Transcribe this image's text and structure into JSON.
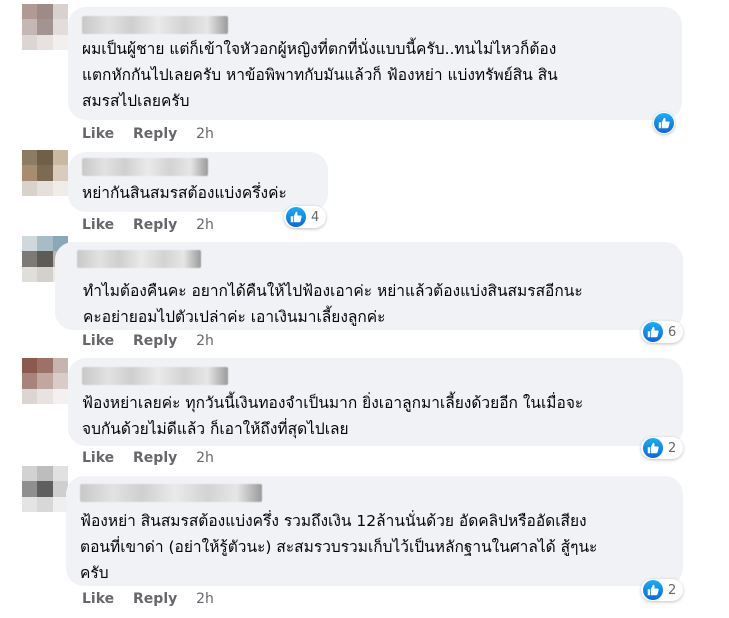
{
  "comments": [
    {
      "lines": [
        "ผมเป็นผู้ชาย แต่ก็เข้าใจหัวอกผู้หญิงที่ตกที่นั่งแบบนี้ครับ..ทนไม่ไหวก็ต้อง",
        "แตกหักกันไปเลยครับ หาข้อพิพาทกับมันแล้วก็ ฟ้องหย่า แบ่งทรัพย์สิน สิน",
        "สมรสไปเลยครับ"
      ],
      "like": "Like",
      "reply": "Reply",
      "time": "2h",
      "reaction_count": ""
    },
    {
      "lines": [
        "หย่ากันสินสมรสต้องแบ่งครึ่งค่ะ"
      ],
      "like": "Like",
      "reply": "Reply",
      "time": "2h",
      "reaction_count": "4"
    },
    {
      "lines": [
        "ทำไมต้องคืนคะ อยากได้คืนให้ไปฟ้องเอาค่ะ หย่าแล้วต้องแบ่งสินสมรสอีกนะ",
        "คะอย่ายอมไปตัวเปล่าค่ะ เอาเงินมาเลี้ยงลูกค่ะ"
      ],
      "like": "Like",
      "reply": "Reply",
      "time": "2h",
      "reaction_count": "6"
    },
    {
      "lines": [
        "ฟ้องหย่าเลยค่ะ ทุกวันนี้เงินทองจำเป็นมาก ยิ่งเอาลูกมาเลี้ยงด้วยอีก ในเมื่อจะ",
        "จบกันด้วยไม่ดีแล้ว ก็เอาให้ถึงที่สุดไปเลย"
      ],
      "like": "Like",
      "reply": "Reply",
      "time": "2h",
      "reaction_count": "2"
    },
    {
      "lines": [
        "ฟ้องหย่า สินสมรสต้องแบ่งครึ่ง รวมถึงเงิน 12ล้านนั่นด้วย อัดคลิปหรืออัดเสียง",
        "ตอนที่เขาด่า (อย่าให้รู้ตัวนะ) สะสมรวบรวมเก็บไว้เป็นหลักฐานในศาลได้ สู้ๆนะ",
        "ครับ"
      ],
      "like": "Like",
      "reply": "Reply",
      "time": "2h",
      "reaction_count": "2"
    }
  ],
  "colors": {
    "bubble": "#f0f2f5",
    "meta": "#65676b",
    "like_blue": "#0a66e4"
  },
  "icons": {
    "reaction": "like-thumb-icon"
  }
}
